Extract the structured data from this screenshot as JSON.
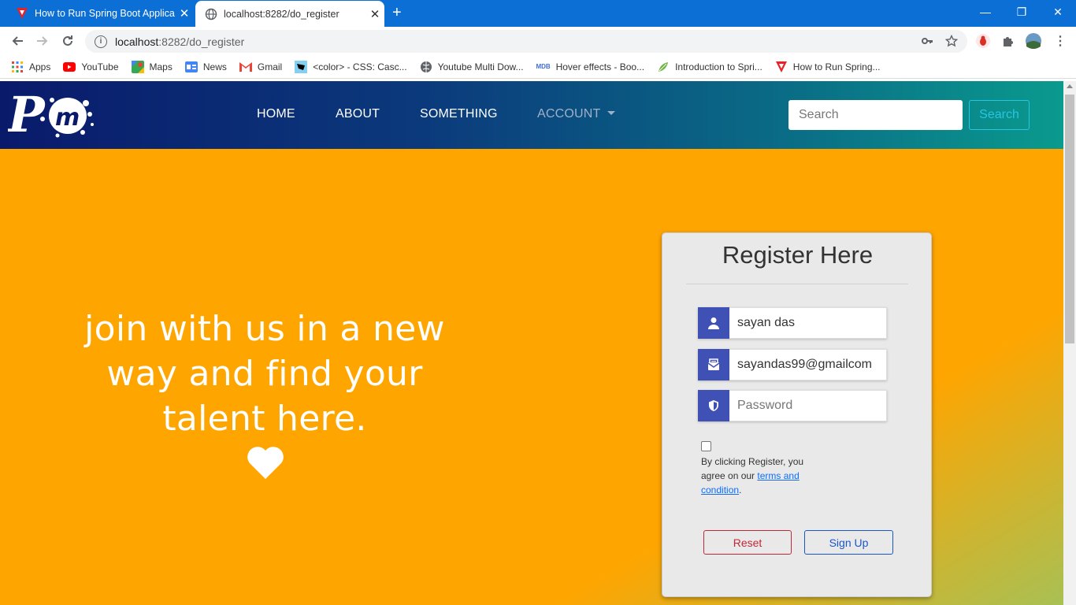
{
  "browser": {
    "tabs": [
      {
        "title": "How to Run Spring Boot Applicat",
        "close": "✕"
      },
      {
        "title": "localhost:8282/do_register",
        "close": "✕"
      }
    ],
    "new_tab": "+",
    "window_controls": [
      "—",
      "❐",
      "✕"
    ],
    "url_host": "localhost",
    "url_path": ":8282/do_register",
    "bookmarks": [
      {
        "label": "Apps",
        "icon": "apps-grid-icon"
      },
      {
        "label": "YouTube",
        "icon": "youtube-icon"
      },
      {
        "label": "Maps",
        "icon": "maps-icon"
      },
      {
        "label": "News",
        "icon": "news-icon"
      },
      {
        "label": "Gmail",
        "icon": "gmail-icon"
      },
      {
        "label": "<color> - CSS: Casc...",
        "icon": "mdn-icon"
      },
      {
        "label": "Youtube Multi Dow...",
        "icon": "globe-icon"
      },
      {
        "label": "Hover effects - Boo...",
        "icon": "mdb-icon"
      },
      {
        "label": "Introduction to Spri...",
        "icon": "spring-icon"
      },
      {
        "label": "How to Run Spring...",
        "icon": "site-icon"
      }
    ]
  },
  "navbar": {
    "links": [
      "HOME",
      "ABOUT",
      "SOMETHING"
    ],
    "account": "ACCOUNT",
    "search_placeholder": "Search",
    "search_button": "Search"
  },
  "hero": {
    "tagline_lines": [
      "join with us in a new",
      "way and find your",
      "talent here."
    ]
  },
  "form": {
    "title": "Register Here",
    "name_value": "sayan das",
    "email_value": "sayandas99@gmailcom",
    "password_placeholder": "Password",
    "terms_prefix": "By clicking Register, you agree on our ",
    "terms_link": "terms and condition",
    "terms_suffix": ".",
    "reset_label": "Reset",
    "signup_label": "Sign Up"
  },
  "colors": {
    "hero_bg": "#ffa500",
    "icon_bg": "#3f51b5",
    "reset": "#c0283a",
    "signup": "#1a56c8"
  }
}
